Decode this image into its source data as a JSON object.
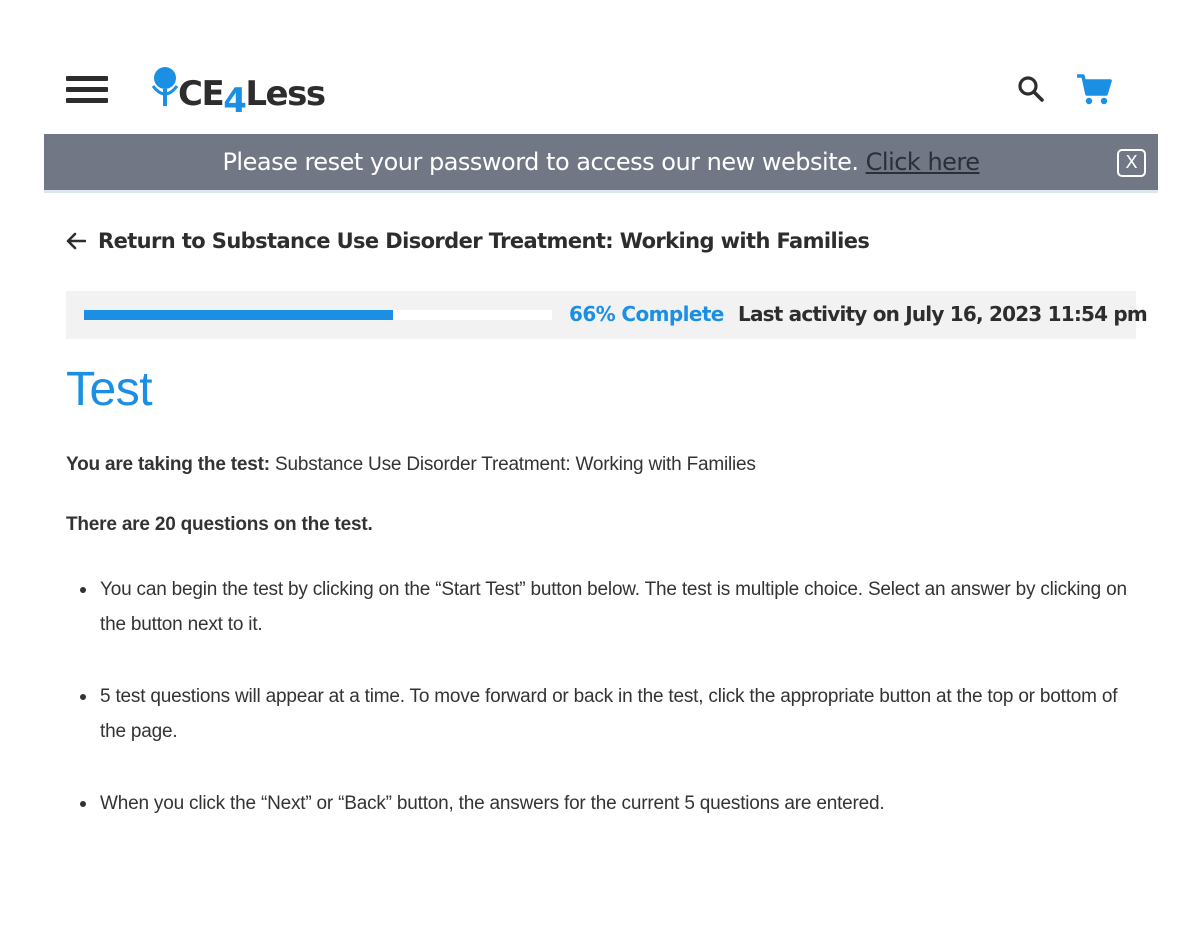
{
  "header": {
    "logo": {
      "text_main": "CE",
      "text_accent": "4",
      "text_end": "Less"
    },
    "menu_icon": "hamburger-menu-icon",
    "search_icon": "search-icon",
    "cart_icon": "cart-icon",
    "accent_color": "#1a8fe3"
  },
  "banner": {
    "message": "Please reset your password to access our new website.",
    "link_label": "Click here",
    "close_label": "X",
    "background": "#717784"
  },
  "back_link": {
    "label": "Return to Substance Use Disorder Treatment: Working with Families"
  },
  "progress": {
    "percent": 66,
    "label": "66% Complete",
    "last_activity": "Last activity on July 16, 2023 11:54 pm"
  },
  "page": {
    "title": "Test",
    "intro_label": "You are taking the test:",
    "intro_value": "Substance Use Disorder Treatment: Working with Families",
    "question_count": "There are 20 questions on the test.",
    "instructions": [
      "You can begin the test by clicking on the “Start Test” button below. The test is multiple choice. Select an answer by clicking on the button next to it.",
      "5 test questions will appear at a time. To move forward or back in the test, click the appropriate button at the top or bottom of the page.",
      "When you click the “Next” or “Back” button, the answers for the current 5 questions are entered."
    ]
  }
}
